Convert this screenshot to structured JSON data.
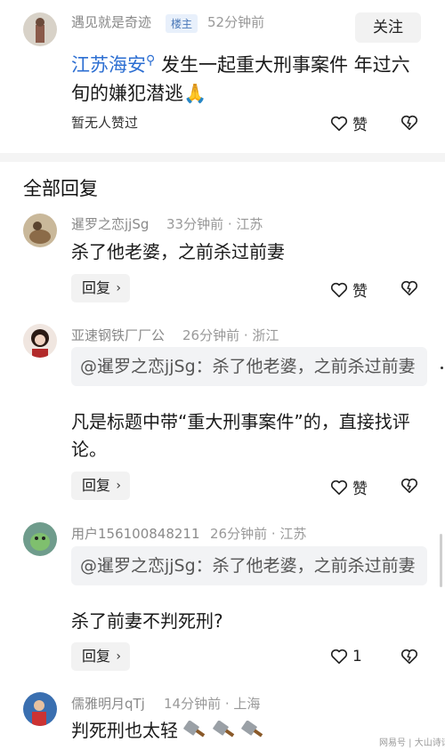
{
  "op": {
    "username": "遇见就是奇迹",
    "badge": "楼主",
    "time": "52分钟前",
    "follow_label": "关注",
    "topic": "江苏海安",
    "text": "发生一起重大刑事案件 年过六旬的嫌犯潜逃🙏",
    "no_likes": "暂无人赞过",
    "like_label": "赞"
  },
  "section_title": "全部回复",
  "comments": [
    {
      "username": "暹罗之恋jjSg",
      "meta": "33分钟前 · 江苏",
      "text": "杀了他老婆，之前杀过前妻",
      "reply_label": "回复",
      "like_label": "赞"
    },
    {
      "username": "亚速钢铁厂厂公",
      "meta": "26分钟前 · 浙江",
      "quote": "@暹罗之恋jjSg：杀了他老婆，之前杀过前妻",
      "text": "凡是标题中带“重大刑事案件”的，直接找评论。",
      "reply_label": "回复",
      "like_label": "赞"
    },
    {
      "username": "用户156100848211",
      "meta": "26分钟前 · 江苏",
      "quote": "@暹罗之恋jjSg：杀了他老婆，之前杀过前妻",
      "text": "杀了前妻不判死刑?",
      "reply_label": "回复",
      "like_label": "1"
    },
    {
      "username": "儒雅明月qTj",
      "meta": "14分钟前 · 上海",
      "text": "判死刑也太轻"
    }
  ],
  "watermark": "网易号 | 大山诗话",
  "colors": {
    "topic": "#2d6fd2",
    "badge_bg": "#e8f0fb"
  }
}
